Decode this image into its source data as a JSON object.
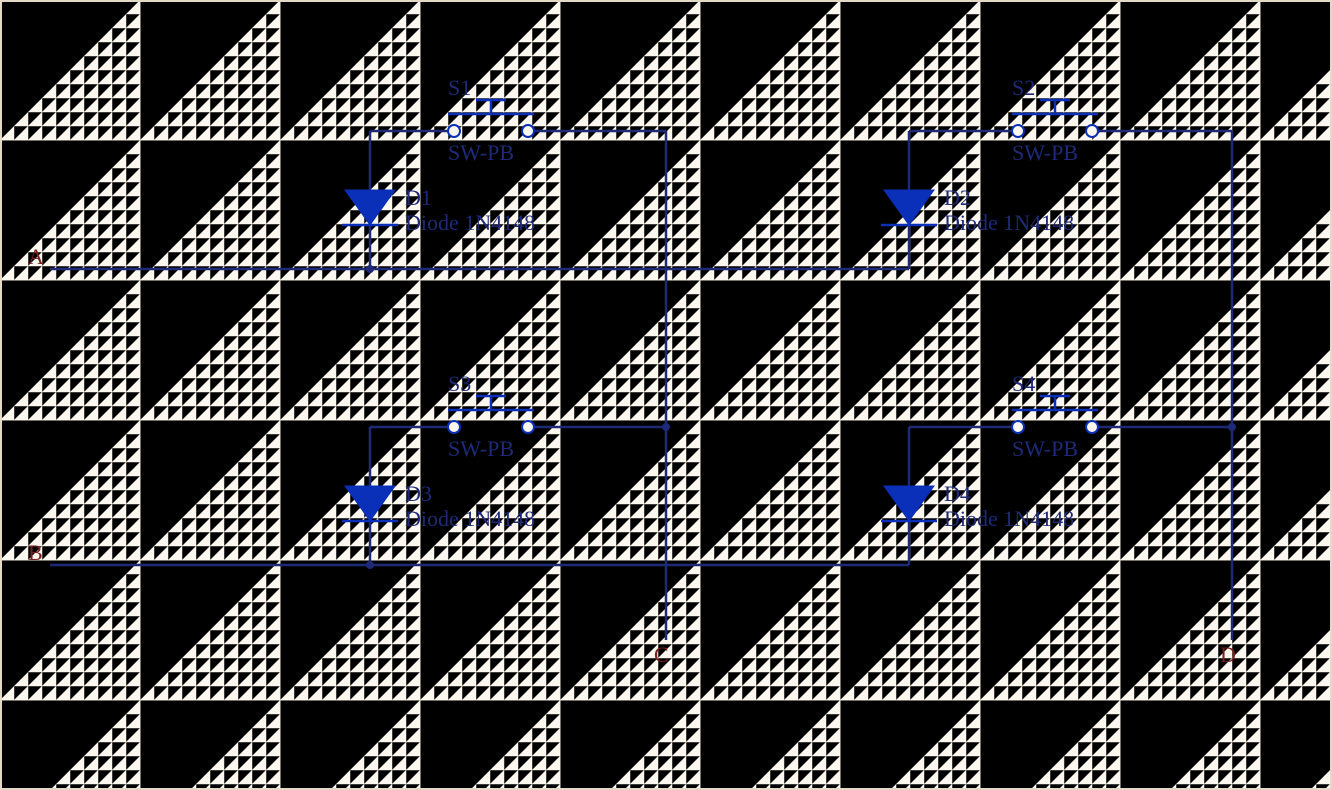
{
  "nets": {
    "A": "A",
    "B": "B",
    "C": "C",
    "D": "D"
  },
  "switches": [
    {
      "ref": "S1",
      "val": "SW-PB"
    },
    {
      "ref": "S2",
      "val": "SW-PB"
    },
    {
      "ref": "S3",
      "val": "SW-PB"
    },
    {
      "ref": "S4",
      "val": "SW-PB"
    }
  ],
  "diodes": [
    {
      "ref": "D1",
      "val": "Diode 1N4148"
    },
    {
      "ref": "D2",
      "val": "Diode 1N4148"
    },
    {
      "ref": "D3",
      "val": "Diode 1N4148"
    },
    {
      "ref": "D4",
      "val": "Diode 1N4148"
    }
  ],
  "colors": {
    "wire": "#1e2a78",
    "comp": "#0a2fb8",
    "netlabel": "#7a1f1f",
    "bg": "#fbf7ef"
  }
}
